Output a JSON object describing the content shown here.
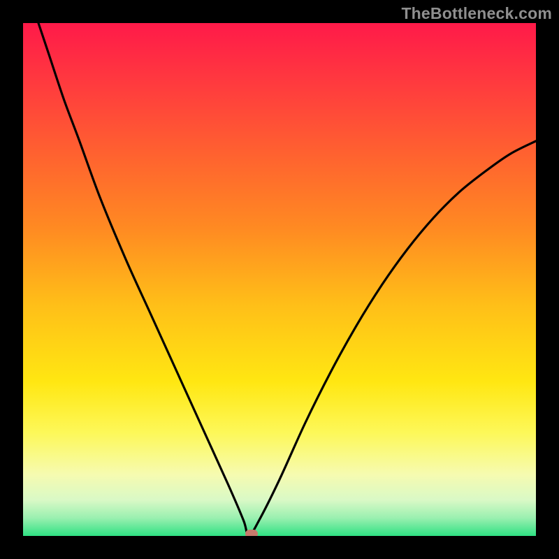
{
  "watermark": "TheBottleneck.com",
  "colors": {
    "background": "#000000",
    "curve": "#000000",
    "marker": "#c77a6c",
    "gradient_stops": [
      {
        "offset": 0.0,
        "color": "#ff1a49"
      },
      {
        "offset": 0.12,
        "color": "#ff3b3e"
      },
      {
        "offset": 0.25,
        "color": "#ff6030"
      },
      {
        "offset": 0.4,
        "color": "#ff8a22"
      },
      {
        "offset": 0.55,
        "color": "#ffbf18"
      },
      {
        "offset": 0.7,
        "color": "#ffe712"
      },
      {
        "offset": 0.8,
        "color": "#fdf85a"
      },
      {
        "offset": 0.88,
        "color": "#f6fbb0"
      },
      {
        "offset": 0.93,
        "color": "#d9f9c6"
      },
      {
        "offset": 0.965,
        "color": "#9af0b0"
      },
      {
        "offset": 1.0,
        "color": "#2fe183"
      }
    ]
  },
  "chart_data": {
    "type": "line",
    "title": "",
    "xlabel": "",
    "ylabel": "",
    "xlim": [
      0,
      1
    ],
    "ylim": [
      0,
      1
    ],
    "grid": false,
    "legend": false,
    "note": "V curve: y≈0 at x≈0.44; left branch reaches y≈1 at x≈0.03; right branch reaches y≈0.77 at x=1",
    "minimum": {
      "x": 0.44,
      "y": 0.0
    },
    "series": [
      {
        "name": "curve",
        "x": [
          0.03,
          0.05,
          0.08,
          0.11,
          0.15,
          0.2,
          0.25,
          0.3,
          0.35,
          0.4,
          0.43,
          0.44,
          0.46,
          0.5,
          0.55,
          0.6,
          0.65,
          0.7,
          0.75,
          0.8,
          0.85,
          0.9,
          0.95,
          1.0
        ],
        "y": [
          1.0,
          0.94,
          0.85,
          0.77,
          0.66,
          0.54,
          0.43,
          0.32,
          0.21,
          0.1,
          0.03,
          0.0,
          0.03,
          0.11,
          0.22,
          0.32,
          0.41,
          0.49,
          0.56,
          0.62,
          0.67,
          0.71,
          0.745,
          0.77
        ]
      }
    ],
    "marker": {
      "x": 0.445,
      "y": 0.0
    }
  }
}
